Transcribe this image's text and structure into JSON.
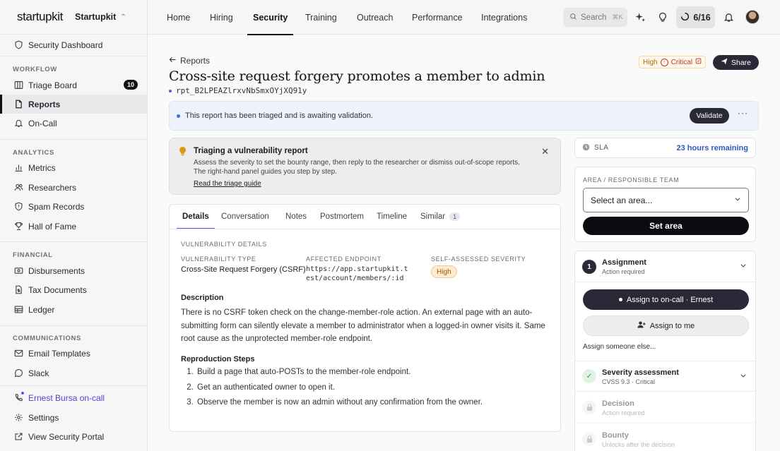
{
  "brand": {
    "logo": "startupkit",
    "org": "Startupkit"
  },
  "sidebar": {
    "top_item": "Security Dashboard",
    "sections": {
      "workflow": "WORKFLOW",
      "analytics": "ANALYTICS",
      "financial": "FINANCIAL",
      "communications": "COMMUNICATIONS"
    },
    "workflow": [
      {
        "label": "Triage Board",
        "badge": "10"
      },
      {
        "label": "Reports"
      },
      {
        "label": "On-Call"
      }
    ],
    "analytics": [
      "Metrics",
      "Researchers",
      "Spam Records",
      "Hall of Fame"
    ],
    "financial": [
      "Disbursements",
      "Tax Documents",
      "Ledger"
    ],
    "communications": [
      "Email Templates",
      "Slack"
    ],
    "bottom": [
      "Ernest Bursa on-call",
      "Settings",
      "View Security Portal"
    ]
  },
  "topnav": {
    "tabs": [
      "Home",
      "Hiring",
      "Security",
      "Training",
      "Outreach",
      "Performance",
      "Integrations"
    ],
    "active": "Security",
    "search_placeholder": "Search",
    "search_shortcut": "⌘K",
    "progress": "6/16"
  },
  "report": {
    "back": "Reports",
    "title": "Cross-site request forgery promotes a member to admin",
    "id": "rpt_B2LPEAZlrxvNbSmxOYjXQ91y",
    "severity_from": "High",
    "severity_to": "Critical",
    "share": "Share",
    "banner": "This report has been triaged and is awaiting validation.",
    "validate": "Validate",
    "more": "···"
  },
  "guide": {
    "title": "Triaging a vulnerability report",
    "body": "Assess the severity to set the bounty range, then reply to the researcher or dismiss out-of-scope reports. The right-hand panel guides you step by step.",
    "link": "Read the triage guide"
  },
  "tabs": [
    {
      "label": "Details"
    },
    {
      "label": "Conversation"
    },
    {
      "label": "Notes"
    },
    {
      "label": "Postmortem"
    },
    {
      "label": "Timeline"
    },
    {
      "label": "Similar",
      "count": "1"
    }
  ],
  "details": {
    "section": "VULNERABILITY DETAILS",
    "type_label": "VULNERABILITY TYPE",
    "type": "Cross-Site Request Forgery (CSRF)",
    "endpoint_label": "AFFECTED ENDPOINT",
    "endpoint": "https://app.startupkit.test/account/members/:id",
    "severity_label": "SELF-ASSESSED SEVERITY",
    "severity": "High",
    "description_title": "Description",
    "description": "There is no CSRF token check on the change-member-role action. An external page with an auto-submitting form can silently elevate a member to administrator when a logged-in owner visits it. Same root cause as the unprotected member-role endpoint.",
    "steps_title": "Reproduction Steps",
    "steps": [
      "Build a page that auto-POSTs to the member-role endpoint.",
      "Get an authenticated owner to open it.",
      "Observe the member is now an admin without any confirmation from the owner."
    ]
  },
  "panel": {
    "sla_label": "SLA",
    "sla_remaining": "23 hours remaining",
    "area_label": "AREA / RESPONSIBLE TEAM",
    "area_select": "Select an area...",
    "set_area": "Set area",
    "assignment": {
      "num": "1",
      "title": "Assignment",
      "sub": "Action required"
    },
    "assign_oncall": "Assign to on-call · Ernest",
    "assign_me": "Assign to me",
    "assign_else": "Assign someone else...",
    "severity_step": {
      "title": "Severity assessment",
      "sub": "CVSS 9.3 · Critical"
    },
    "decision_step": {
      "title": "Decision",
      "sub": "Action required"
    },
    "bounty_step": {
      "title": "Bounty",
      "sub": "Unlocks after the decision"
    }
  },
  "colors": {
    "accent": "#6a4cf0",
    "dark_button": "#2b2838",
    "sla_blue": "#2d5bbf"
  }
}
